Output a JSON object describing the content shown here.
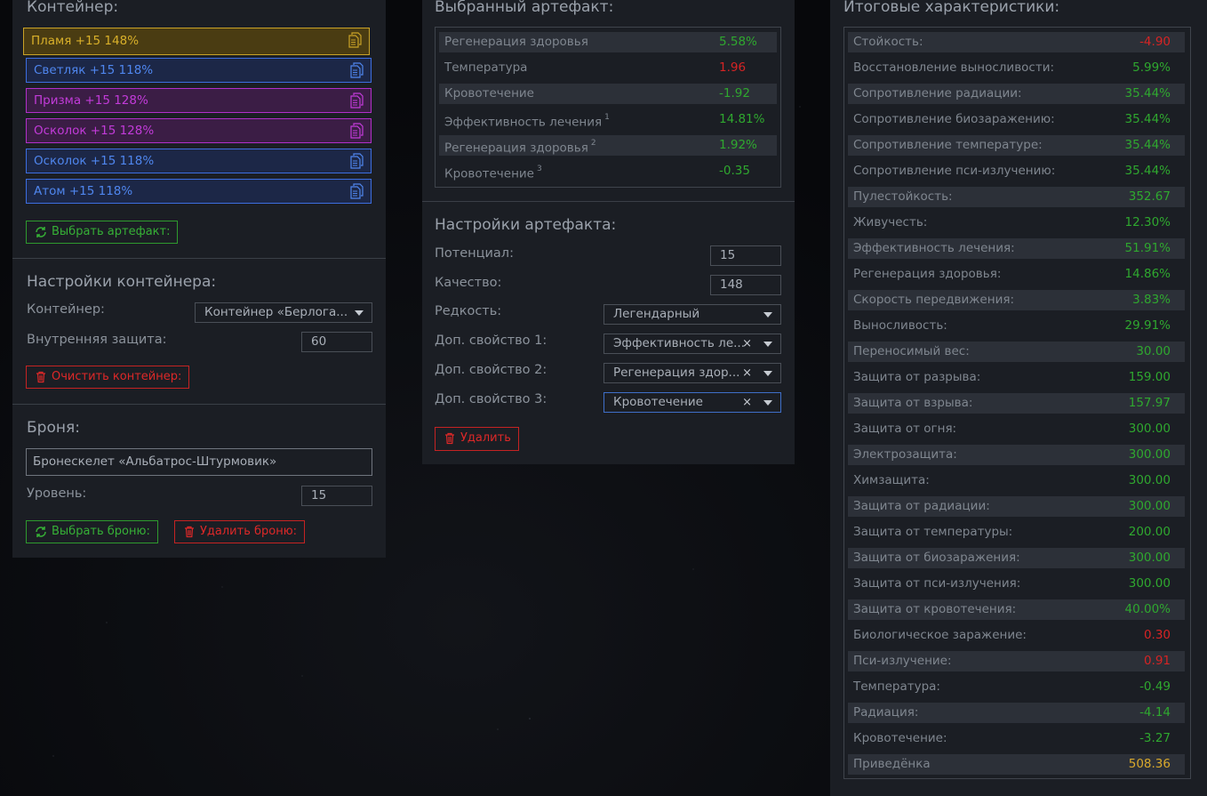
{
  "container_panel": {
    "title": "Контейнер:",
    "slots": [
      {
        "label": "Пламя +15 148%",
        "color": "gold"
      },
      {
        "label": "Светляк +15 118%",
        "color": "blue"
      },
      {
        "label": "Призма +15 128%",
        "color": "purple"
      },
      {
        "label": "Осколок +15 128%",
        "color": "purple"
      },
      {
        "label": "Осколок +15 118%",
        "color": "blue"
      },
      {
        "label": "Атом +15 118%",
        "color": "blue"
      }
    ],
    "choose_artifact_label": "Выбрать артефакт:",
    "settings_title": "Настройки контейнера:",
    "container_label": "Контейнер:",
    "container_value": "Контейнер «Берлога...",
    "inner_protection_label": "Внутренняя защита:",
    "inner_protection_value": "60",
    "clear_container_label": "Очистить контейнер:",
    "armor_title": "Броня:",
    "armor_value": "Бронескелет «Альбатрос-Штурмовик»",
    "level_label": "Уровень:",
    "level_value": "15",
    "choose_armor_label": "Выбрать броню:",
    "delete_armor_label": "Удалить броню:"
  },
  "artifact_panel": {
    "title": "Выбранный артефакт:",
    "stats": [
      {
        "name": "Регенерация здоровья",
        "sup": "",
        "value": "5.58%",
        "tone": "green"
      },
      {
        "name": "Температура",
        "sup": "",
        "value": "1.96",
        "tone": "red"
      },
      {
        "name": "Кровотечение",
        "sup": "",
        "value": "-1.92",
        "tone": "green"
      },
      {
        "name": "Эффективность лечения",
        "sup": "1",
        "value": "14.81%",
        "tone": "green"
      },
      {
        "name": "Регенерация здоровья",
        "sup": "2",
        "value": "1.92%",
        "tone": "green"
      },
      {
        "name": "Кровотечение",
        "sup": "3",
        "value": "-0.35",
        "tone": "green"
      }
    ],
    "settings_title": "Настройки артефакта:",
    "potential_label": "Потенциал:",
    "potential_value": "15",
    "quality_label": "Качество:",
    "quality_value": "148",
    "rarity_label": "Редкость:",
    "rarity_value": "Легендарный",
    "extra1_label": "Доп. свойство 1:",
    "extra1_value": "Эффективность ле...",
    "extra2_label": "Доп. свойство 2:",
    "extra2_value": "Регенерация здор...",
    "extra3_label": "Доп. свойство 3:",
    "extra3_value": "Кровотечение",
    "clear_glyph": "×",
    "delete_label": "Удалить"
  },
  "stats_panel": {
    "title": "Итоговые характеристики:",
    "rows": [
      {
        "name": "Стойкость:",
        "value": "-4.90",
        "tone": "red"
      },
      {
        "name": "Восстановление выносливости:",
        "value": "5.99%",
        "tone": "green"
      },
      {
        "name": "Сопротивление радиации:",
        "value": "35.44%",
        "tone": "green"
      },
      {
        "name": "Сопротивление биозаражению:",
        "value": "35.44%",
        "tone": "green"
      },
      {
        "name": "Сопротивление температуре:",
        "value": "35.44%",
        "tone": "green"
      },
      {
        "name": "Сопротивление пси-излучению:",
        "value": "35.44%",
        "tone": "green"
      },
      {
        "name": "Пулестойкость:",
        "value": "352.67",
        "tone": "green"
      },
      {
        "name": "Живучесть:",
        "value": "12.30%",
        "tone": "green"
      },
      {
        "name": "Эффективность лечения:",
        "value": "51.91%",
        "tone": "green"
      },
      {
        "name": "Регенерация здоровья:",
        "value": "14.86%",
        "tone": "green"
      },
      {
        "name": "Скорость передвижения:",
        "value": "3.83%",
        "tone": "green"
      },
      {
        "name": "Выносливость:",
        "value": "29.91%",
        "tone": "green"
      },
      {
        "name": "Переносимый вес:",
        "value": "30.00",
        "tone": "green"
      },
      {
        "name": "Защита от разрыва:",
        "value": "159.00",
        "tone": "green"
      },
      {
        "name": "Защита от взрыва:",
        "value": "157.97",
        "tone": "green"
      },
      {
        "name": "Защита от огня:",
        "value": "300.00",
        "tone": "green"
      },
      {
        "name": "Электрозащита:",
        "value": "300.00",
        "tone": "green"
      },
      {
        "name": "Химзащита:",
        "value": "300.00",
        "tone": "green"
      },
      {
        "name": "Защита от радиации:",
        "value": "300.00",
        "tone": "green"
      },
      {
        "name": "Защита от температуры:",
        "value": "200.00",
        "tone": "green"
      },
      {
        "name": "Защита от биозаражения:",
        "value": "300.00",
        "tone": "green"
      },
      {
        "name": "Защита от пси-излучения:",
        "value": "300.00",
        "tone": "green"
      },
      {
        "name": "Защита от кровотечения:",
        "value": "40.00%",
        "tone": "green"
      },
      {
        "name": "Биологическое заражение:",
        "value": "0.30",
        "tone": "red"
      },
      {
        "name": "Пси-излучение:",
        "value": "0.91",
        "tone": "red"
      },
      {
        "name": "Температура:",
        "value": "-0.49",
        "tone": "green"
      },
      {
        "name": "Радиация:",
        "value": "-4.14",
        "tone": "green"
      },
      {
        "name": "Кровотечение:",
        "value": "-3.27",
        "tone": "green"
      },
      {
        "name": "Приведёнка",
        "value": "508.36",
        "tone": "gold"
      }
    ]
  },
  "colors": {
    "green": "#2fa82f",
    "red": "#d62424",
    "gold": "#d9a92c",
    "blue": "#4f86ee",
    "purple": "#c23bd9"
  }
}
